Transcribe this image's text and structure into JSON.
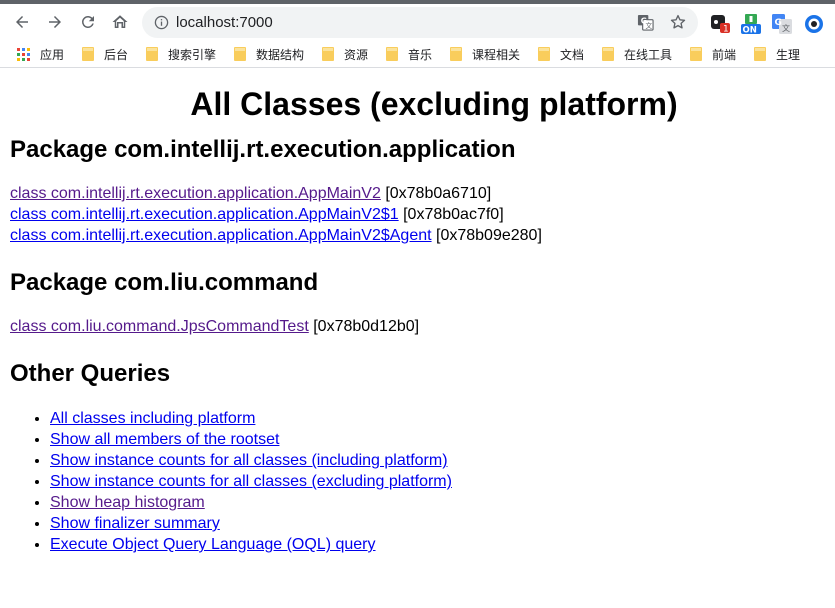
{
  "browser": {
    "url": "localhost:7000",
    "extensions": [
      {
        "name": "extension-badge-1",
        "badge": "1"
      },
      {
        "name": "extension-on",
        "badge": "ON"
      }
    ],
    "bookmarks": [
      {
        "label": "应用"
      },
      {
        "label": "后台"
      },
      {
        "label": "搜索引擎"
      },
      {
        "label": "数据结构"
      },
      {
        "label": "资源"
      },
      {
        "label": "音乐"
      },
      {
        "label": "课程相关"
      },
      {
        "label": "文档"
      },
      {
        "label": "在线工具"
      },
      {
        "label": "前端"
      },
      {
        "label": "生理"
      }
    ]
  },
  "page": {
    "title": "All Classes (excluding platform)",
    "packages": [
      {
        "heading": "Package com.intellij.rt.execution.application",
        "classes": [
          {
            "link": "class com.intellij.rt.execution.application.AppMainV2",
            "addr": "[0x78b0a6710]"
          },
          {
            "link": "class com.intellij.rt.execution.application.AppMainV2$1",
            "addr": "[0x78b0ac7f0]"
          },
          {
            "link": "class com.intellij.rt.execution.application.AppMainV2$Agent",
            "addr": "[0x78b09e280]"
          }
        ]
      },
      {
        "heading": "Package com.liu.command",
        "classes": [
          {
            "link": "class com.liu.command.JpsCommandTest",
            "addr": "[0x78b0d12b0]"
          }
        ]
      }
    ],
    "other_heading": "Other Queries",
    "queries": [
      "All classes including platform",
      "Show all members of the rootset",
      "Show instance counts for all classes (including platform)",
      "Show instance counts for all classes (excluding platform)",
      "Show heap histogram",
      "Show finalizer summary",
      "Execute Object Query Language (OQL) query"
    ]
  }
}
